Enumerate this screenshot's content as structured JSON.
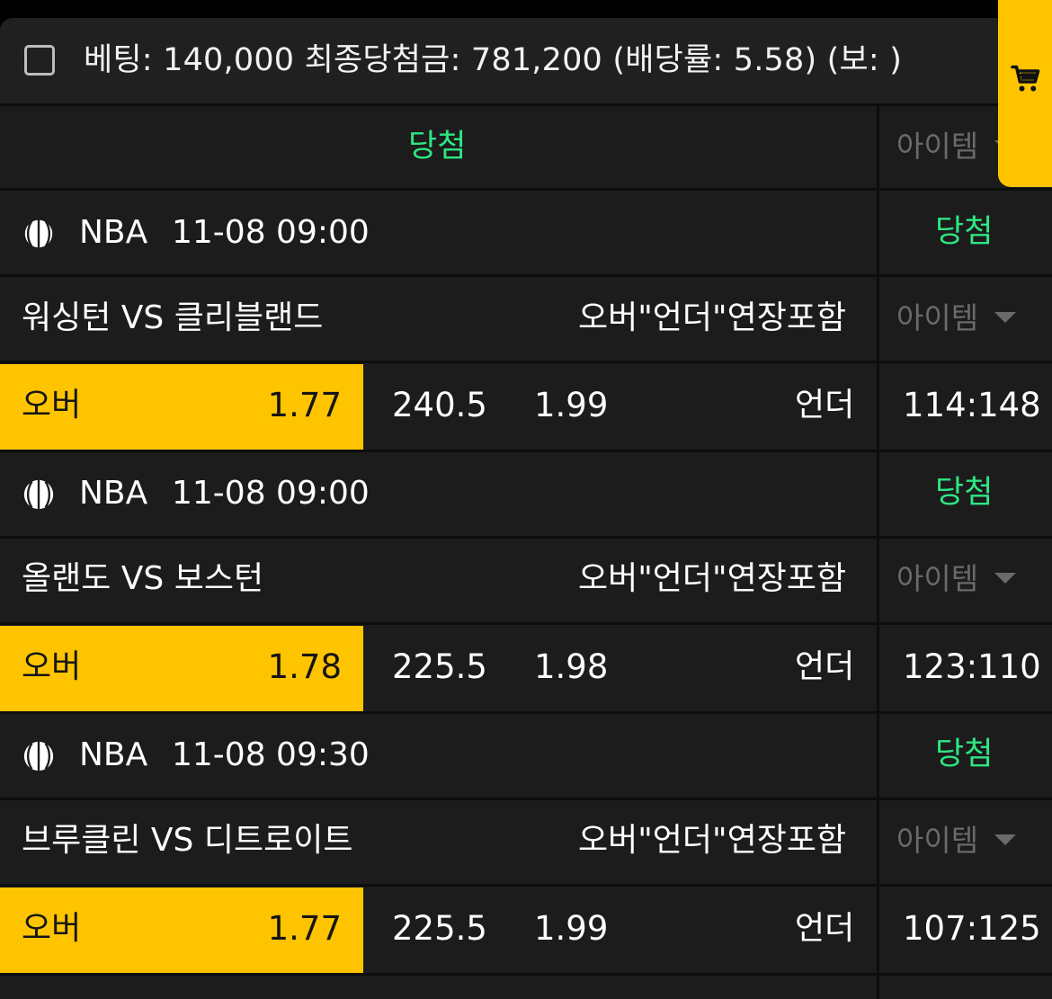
{
  "header": {
    "summary": "베팅: 140,000 최종당첨금: 781,200 (배당률: 5.58) (보: )"
  },
  "status_row": {
    "status": "당첨",
    "item_label": "아이템"
  },
  "cart": {
    "icon": "cart-icon",
    "color": "#ffc400"
  },
  "colors": {
    "accent": "#ffc400",
    "win": "#2ee683",
    "muted": "#6a6a6a"
  },
  "games": [
    {
      "sport_icon": "basketball-icon",
      "league": "NBA",
      "datetime": "11-08 09:00",
      "status": "당첨",
      "teams": "워싱턴 VS 클리블랜드",
      "market": "오버\"언더\"연장포함",
      "item_label": "아이템",
      "over_label": "오버",
      "over_odds": "1.77",
      "line": "240.5",
      "under_odds": "1.99",
      "under_label": "언더",
      "score": "114:148"
    },
    {
      "sport_icon": "basketball-icon",
      "league": "NBA",
      "datetime": "11-08 09:00",
      "status": "당첨",
      "teams": "올랜도 VS 보스턴",
      "market": "오버\"언더\"연장포함",
      "item_label": "아이템",
      "over_label": "오버",
      "over_odds": "1.78",
      "line": "225.5",
      "under_odds": "1.98",
      "under_label": "언더",
      "score": "123:110"
    },
    {
      "sport_icon": "basketball-icon",
      "league": "NBA",
      "datetime": "11-08 09:30",
      "status": "당첨",
      "teams": "브루클린 VS 디트로이트",
      "market": "오버\"언더\"연장포함",
      "item_label": "아이템",
      "over_label": "오버",
      "over_odds": "1.77",
      "line": "225.5",
      "under_odds": "1.99",
      "under_label": "언더",
      "score": "107:125"
    }
  ]
}
